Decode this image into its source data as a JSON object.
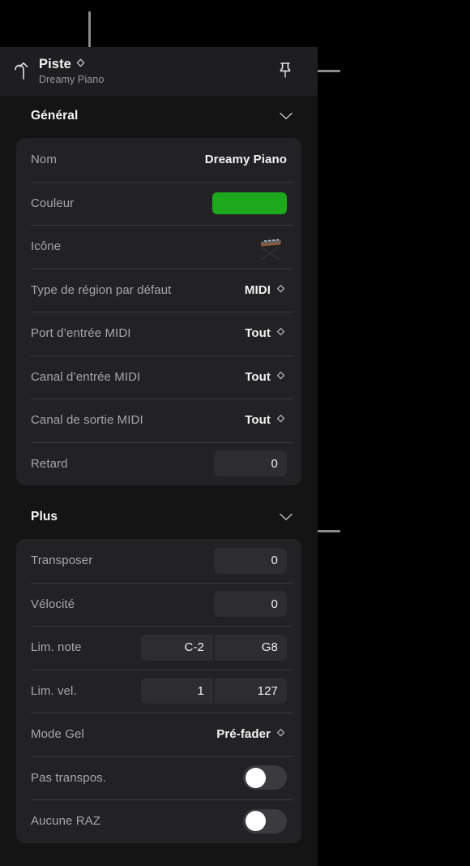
{
  "header": {
    "back_icon": "back-arrow-icon",
    "title": "Piste",
    "title_chevron_icon": "updown-chevron-icon",
    "subtitle": "Dreamy Piano",
    "pin_icon": "pin-icon"
  },
  "sections": [
    {
      "id": "general",
      "title": "Général",
      "chevron_icon": "chevron-down-icon",
      "rows": [
        {
          "id": "nom",
          "label": "Nom",
          "type": "text",
          "value": "Dreamy Piano"
        },
        {
          "id": "couleur",
          "label": "Couleur",
          "type": "color",
          "value": "#1da81d"
        },
        {
          "id": "icone",
          "label": "Icône",
          "type": "icon",
          "value": "keyboard-stand-icon"
        },
        {
          "id": "type-region",
          "label": "Type de région par défaut",
          "type": "popup",
          "value": "MIDI"
        },
        {
          "id": "port-entree-midi",
          "label": "Port d’entrée MIDI",
          "type": "popup",
          "value": "Tout"
        },
        {
          "id": "canal-entree-midi",
          "label": "Canal d’entrée MIDI",
          "type": "popup",
          "value": "Tout"
        },
        {
          "id": "canal-sortie-midi",
          "label": "Canal de sortie MIDI",
          "type": "popup",
          "value": "Tout"
        },
        {
          "id": "retard",
          "label": "Retard",
          "type": "field",
          "value": "0"
        }
      ]
    },
    {
      "id": "plus",
      "title": "Plus",
      "chevron_icon": "chevron-down-icon",
      "rows": [
        {
          "id": "transposer",
          "label": "Transposer",
          "type": "field",
          "value": "0"
        },
        {
          "id": "velocite",
          "label": "Vélocité",
          "type": "field",
          "value": "0"
        },
        {
          "id": "lim-note",
          "label": "Lim. note",
          "type": "field-pair",
          "value": "C-2",
          "value2": "G8"
        },
        {
          "id": "lim-vel",
          "label": "Lim. vel.",
          "type": "field-pair",
          "value": "1",
          "value2": "127"
        },
        {
          "id": "mode-gel",
          "label": "Mode Gel",
          "type": "popup",
          "value": "Pré-fader"
        },
        {
          "id": "pas-transpos",
          "label": "Pas transpos.",
          "type": "toggle",
          "value": "off"
        },
        {
          "id": "aucune-raz",
          "label": "Aucune RAZ",
          "type": "toggle",
          "value": "off"
        }
      ]
    }
  ],
  "callouts": {
    "line_color": "#8a8a8a",
    "items": [
      {
        "id": "callout-track-chevron",
        "orientation": "vertical"
      },
      {
        "id": "callout-pin",
        "orientation": "horizontal"
      },
      {
        "id": "callout-plus-chevron",
        "orientation": "horizontal"
      }
    ]
  }
}
